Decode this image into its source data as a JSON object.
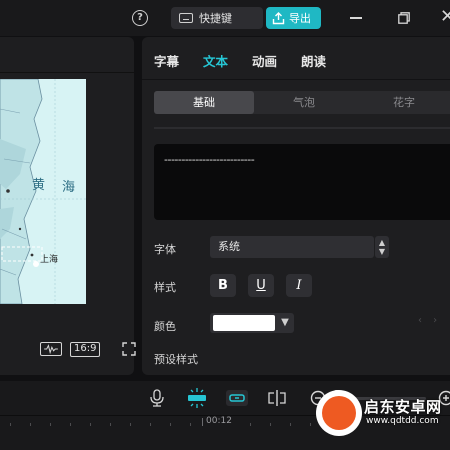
{
  "titlebar": {
    "help_glyph": "?",
    "shortcut_label": "快捷键",
    "export_label": "导出",
    "close_glyph": "✕"
  },
  "player": {
    "map_labels": [
      "黄",
      "海",
      "上海"
    ],
    "ratio_label": "16:9"
  },
  "inspector": {
    "tabs": [
      {
        "label": "字幕",
        "active": false
      },
      {
        "label": "文本",
        "active": true
      },
      {
        "label": "动画",
        "active": false
      },
      {
        "label": "朗读",
        "active": false
      }
    ],
    "segments": [
      {
        "label": "基础",
        "active": true
      },
      {
        "label": "气泡",
        "active": false
      },
      {
        "label": "花字",
        "active": false
      }
    ],
    "text_content": "--------------------------",
    "font_label": "字体",
    "font_value": "系统",
    "style_label": "样式",
    "style_buttons": [
      "B",
      "U",
      "I"
    ],
    "color_label": "颜色",
    "color_value": "#ffffff",
    "preset_label": "预设样式"
  },
  "timeline": {
    "timecode": "00:12"
  },
  "watermark": {
    "title": "启东安卓网",
    "url": "www.qdtdd.com"
  },
  "colors": {
    "accent": "#26c6d4",
    "export_bg": "#1fb8c4",
    "panel_bg": "#1e1e20",
    "app_bg": "#101012"
  },
  "icons": [
    "help-icon",
    "keyboard-icon",
    "export-icon",
    "minimize-icon",
    "maximize-icon",
    "close-icon",
    "waveform-icon",
    "fullscreen-icon",
    "microphone-icon",
    "auto-snap-icon",
    "link-icon",
    "split-icon",
    "zoom-out-icon",
    "zoom-in-icon"
  ]
}
